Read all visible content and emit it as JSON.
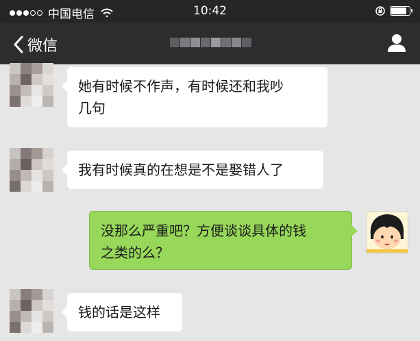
{
  "status_bar": {
    "carrier": "中国电信",
    "time": "10:42",
    "signal_bars_filled": 3,
    "signal_bars_total": 5,
    "battery_level": 0.9
  },
  "nav_bar": {
    "back_label": "微信",
    "contact_name_obscured": true
  },
  "messages": [
    {
      "side": "in",
      "text_line1": "她有时候不作声，有时候还和我吵",
      "text_line2": "几句"
    },
    {
      "side": "in",
      "text_line1": "我有时候真的在想是不是娶错人了"
    },
    {
      "side": "out",
      "text_line1": "没那么严重吧？方便谈谈具体的钱",
      "text_line2": "之类的么？"
    },
    {
      "side": "in",
      "text_line1": "钱的话是这样"
    }
  ],
  "colors": {
    "background": "#e6e6e6",
    "nav_bar": "#2d2d2f",
    "status_bar": "#262626",
    "incoming_bubble": "#ffffff",
    "outgoing_bubble": "#97d75a"
  },
  "icons": {
    "back": "chevron-left-icon",
    "contact_info": "person-icon",
    "wifi": "wifi-icon",
    "battery": "battery-icon",
    "rotation_lock": "rotation-lock-icon"
  }
}
